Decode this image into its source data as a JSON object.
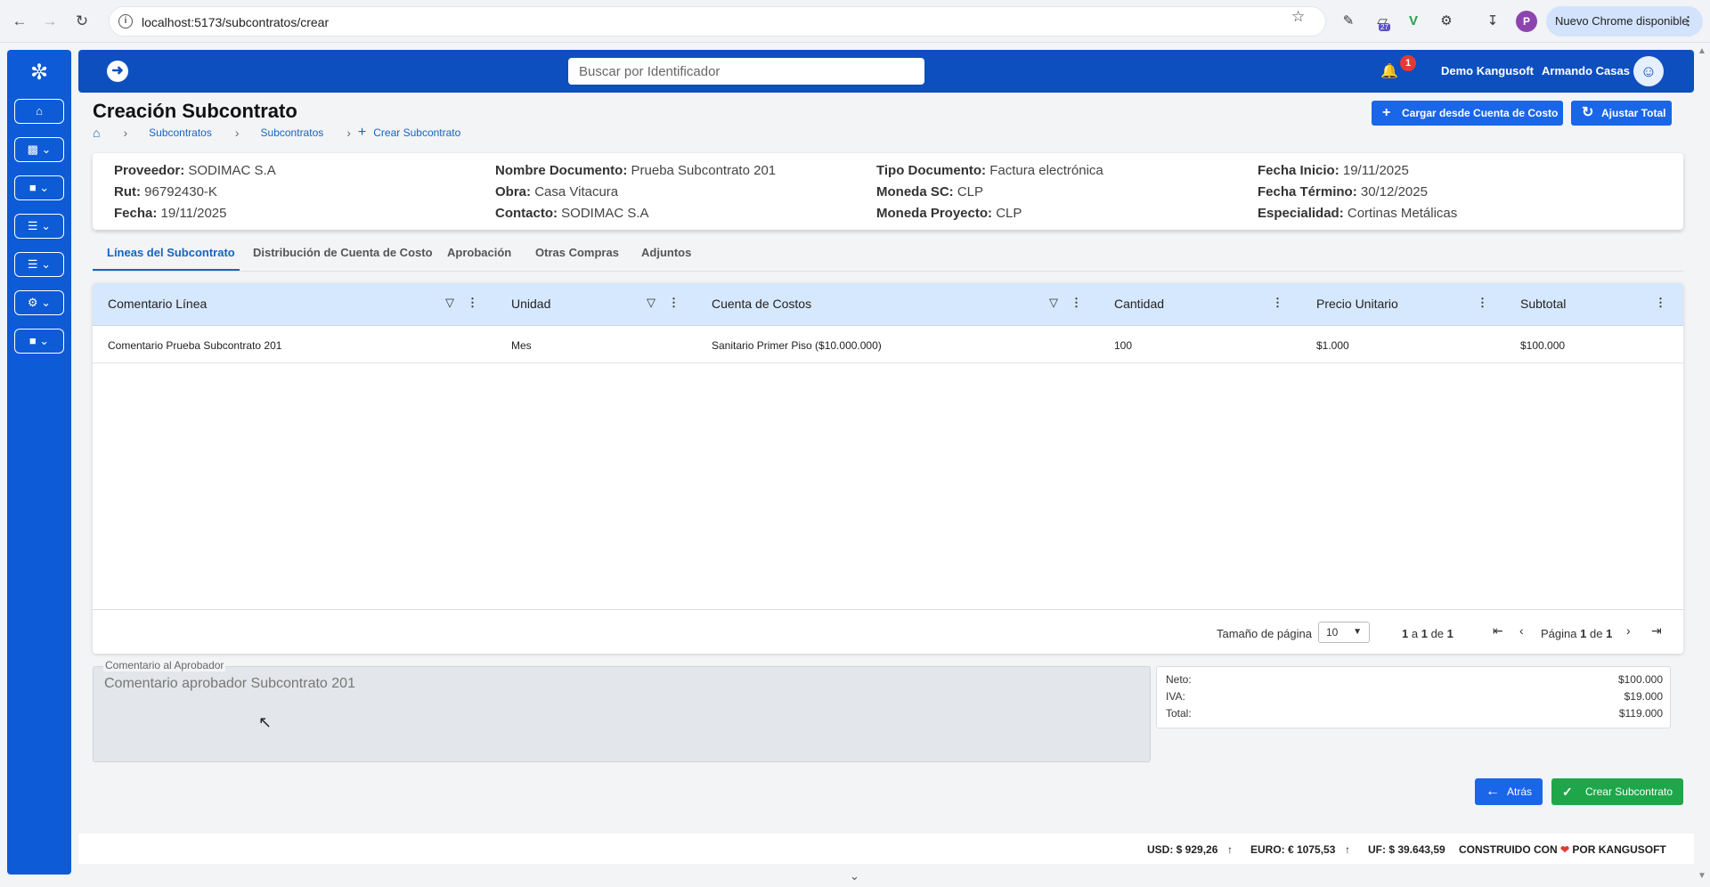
{
  "browser": {
    "url": "localhost:5173/subcontratos/crear",
    "update_label": "Nuevo Chrome disponible",
    "profile_initial": "P",
    "ext_badge": "27"
  },
  "header": {
    "search_placeholder": "Buscar por Identificador",
    "notifications_count": "1",
    "company": "Demo Kangusoft",
    "user": "Armando Casas"
  },
  "page": {
    "title": "Creación Subcontrato",
    "breadcrumb": [
      "Subcontratos",
      "Subcontratos",
      "Crear Subcontrato"
    ],
    "btn_load_cost": "Cargar desde Cuenta de Costo",
    "btn_adjust": "Ajustar Total"
  },
  "info": {
    "col1": [
      {
        "label": "Proveedor:",
        "value": "SODIMAC S.A"
      },
      {
        "label": "Rut:",
        "value": "96792430-K"
      },
      {
        "label": "Fecha:",
        "value": "19/11/2025"
      }
    ],
    "col2": [
      {
        "label": "Nombre Documento:",
        "value": "Prueba Subcontrato 201"
      },
      {
        "label": "Obra:",
        "value": "Casa Vitacura"
      },
      {
        "label": "Contacto:",
        "value": "SODIMAC S.A"
      }
    ],
    "col3": [
      {
        "label": "Tipo Documento:",
        "value": "Factura electrónica"
      },
      {
        "label": "Moneda SC:",
        "value": "CLP"
      },
      {
        "label": "Moneda Proyecto:",
        "value": "CLP"
      }
    ],
    "col4": [
      {
        "label": "Fecha Inicio:",
        "value": "19/11/2025"
      },
      {
        "label": "Fecha Término:",
        "value": "30/12/2025"
      },
      {
        "label": "Especialidad:",
        "value": "Cortinas Metálicas"
      }
    ]
  },
  "tabs": [
    "Líneas del Subcontrato",
    "Distribución de Cuenta de Costo",
    "Aprobación",
    "Otras Compras",
    "Adjuntos"
  ],
  "grid": {
    "columns": [
      "Comentario Línea",
      "Unidad",
      "Cuenta de Costos",
      "Cantidad",
      "Precio Unitario",
      "Subtotal"
    ],
    "rows": [
      [
        "Comentario Prueba Subcontrato 201",
        "Mes",
        "Sanitario Primer Piso ($10.000.000)",
        "100",
        "$1.000",
        "$100.000"
      ]
    ],
    "page_size_label": "Tamaño de página",
    "page_size": "10",
    "range_a": "1",
    "range_a_sep": "a",
    "range_b": "1",
    "range_b_sep": "de",
    "range_c": "1",
    "page_word": "Página",
    "page_num": "1",
    "page_of": "de",
    "page_total": "1"
  },
  "comment": {
    "label": "Comentario al Aprobador",
    "value": "Comentario aprobador Subcontrato 201"
  },
  "totals": [
    {
      "label": "Neto:",
      "value": "$100.000"
    },
    {
      "label": "IVA:",
      "value": "$19.000"
    },
    {
      "label": "Total:",
      "value": "$119.000"
    }
  ],
  "actions": {
    "back": "Atrás",
    "create": "Crear Subcontrato"
  },
  "footer": {
    "usd": "USD: $ 929,26",
    "euro": "EURO: € 1075,53",
    "uf": "UF: $ 39.643,59",
    "built_prefix": "CONSTRUIDO CON",
    "built_suffix": "POR KANGUSOFT"
  },
  "colors": {
    "brand_blue": "#0d4fbf",
    "sidebar_blue": "#0d5bd6",
    "button_blue": "#1a66e8",
    "create_green": "#1fa64a",
    "grid_header": "#d6e8fd",
    "badge_red": "#e53935"
  }
}
